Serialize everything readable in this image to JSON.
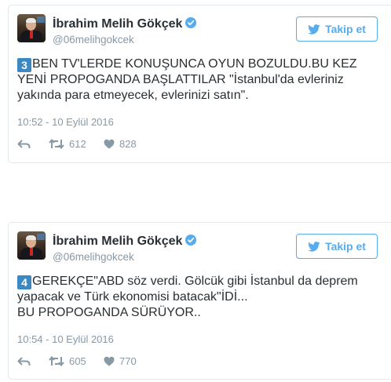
{
  "tweets": [
    {
      "author_name": "İbrahim Melih Gökçek",
      "handle": "@06melihgokcek",
      "follow_label": "Takip et",
      "number_badge": "3",
      "text": "BEN TV'LERDE KONUŞUNCA OYUN BOZULDU.BU KEZ\nYENİ PROPOGANDA BAŞLATTILAR \"İstanbul'da evleriniz\nyakında para etmeyecek, evlerinizi satın\".",
      "timestamp": "10:52 - 10 Eylül 2016",
      "retweets": "612",
      "likes": "828"
    },
    {
      "author_name": "İbrahim Melih Gökçek",
      "handle": "@06melihgokcek",
      "follow_label": "Takip et",
      "number_badge": "4",
      "text": "GEREKÇE\"ABD söz verdi. Gölcük gibi İstanbul da deprem\nyapacak ve Türk ekonomisi batacak\"İDİ...\nBU PROPOGANDA SÜRÜYOR..",
      "timestamp": "10:54 - 10 Eylül 2016",
      "retweets": "605",
      "likes": "770"
    }
  ],
  "icons": {
    "verified": "verified-badge-icon",
    "follow": "twitter-bird-icon",
    "reply": "reply-arrow-icon",
    "retweet": "retweet-icon",
    "like": "heart-icon"
  },
  "colors": {
    "accent": "#55acee",
    "meta": "#8899a6",
    "text": "#292f33",
    "badge": "#3b88c3"
  }
}
